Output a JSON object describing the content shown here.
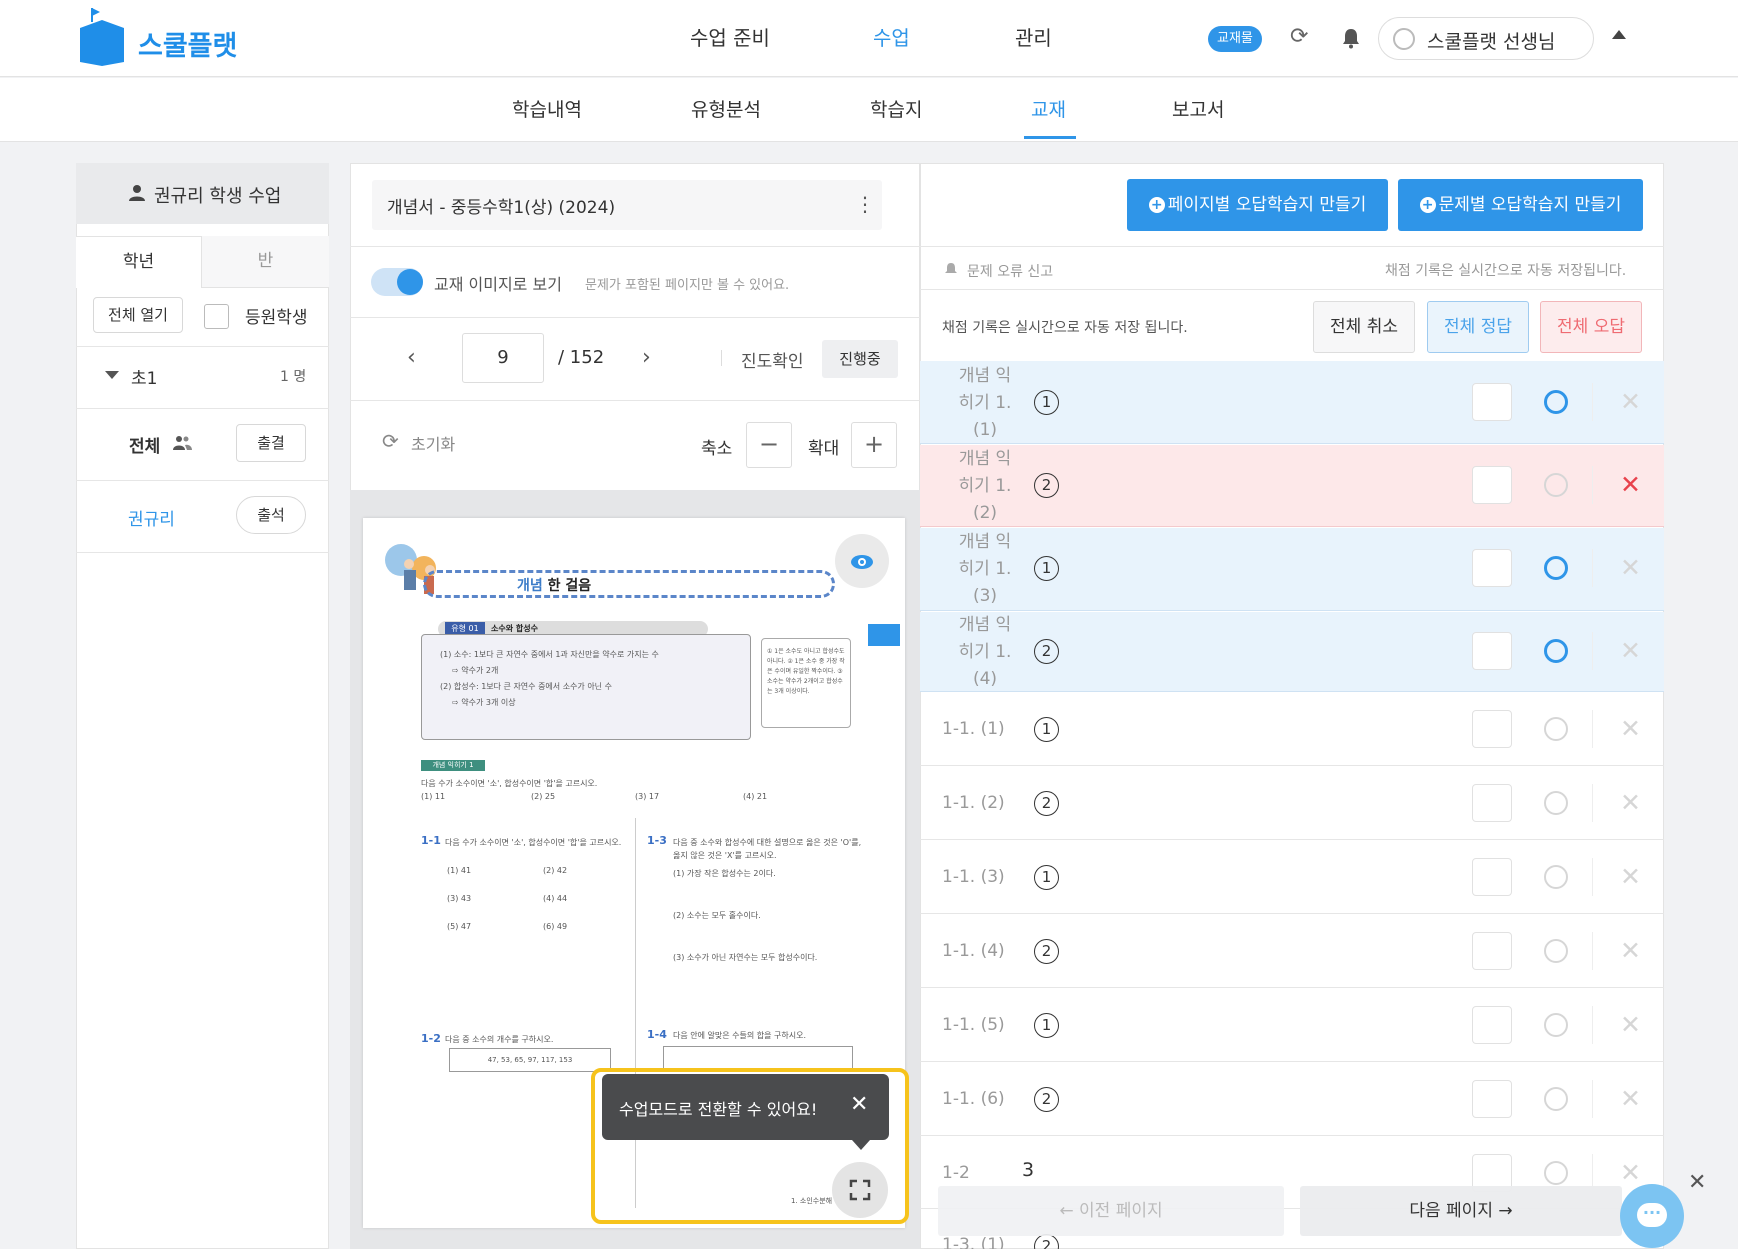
{
  "app": {
    "brand": "스쿨플랫",
    "badge": "교재물",
    "user": "스쿨플랫 선생님"
  },
  "nav": {
    "items": [
      "수업 준비",
      "수업",
      "관리"
    ]
  },
  "subnav": {
    "items": [
      "학습내역",
      "유형분석",
      "학습지",
      "교재",
      "보고서"
    ]
  },
  "left": {
    "header": "권규리 학생 수업",
    "tabs": [
      "학년",
      "반"
    ],
    "open_all": "전체 열기",
    "enrolled": "등원학생",
    "grade": "초1",
    "grade_count": "1 명",
    "all_label": "전체",
    "attend_all": "출결",
    "student": "권규리",
    "student_status": "출석"
  },
  "middle": {
    "book_title": "개념서 - 중등수학1(상) (2024)",
    "toggle_label": "교재 이미지로 보기",
    "toggle_hint": "문제가 포함된 페이지만 볼 수 있어요.",
    "page_current": "9",
    "page_total": "/ 152",
    "progress_label": "진도확인",
    "progress_status": "진행중",
    "reset": "초기화",
    "zoom_out": "축소",
    "zoom_in": "확대",
    "tooltip": "수업모드로 전환할 수 있어요!"
  },
  "textbook": {
    "header_title_1": "개념",
    "header_title_2": "한 걸음",
    "type_badge": "유형 01",
    "type_title": "소수와 합성수",
    "box_lines": [
      "(1) 소수: 1보다 큰 자연수 중에서 1과 자신만을 약수로 가지는 수",
      "⇨ 약수가 2개",
      "(2) 합성수: 1보다 큰 자연수 중에서 소수가 아닌 수",
      "⇨ 약수가 3개 이상"
    ],
    "side_note": "① 1은 소수도 아니고 합성수도 아니다. ② 1은 소수 중 가장 작은 수이며 유일한 짝수이다. ③ 소수는 약수가 2개이고 합성수는 3개 이상이다.",
    "concept_tag": "개념 익히기 1",
    "q_main": "다음 수가 소수이면 '소', 합성수이면 '합'을 고르시오.",
    "q_main_opts": [
      "(1) 11",
      "(2) 25",
      "(3) 17",
      "(4) 21"
    ],
    "q11": "다음 수가 소수이면 '소', 합성수이면 '합'을 고르시오.",
    "q11_opts": [
      "(1) 41",
      "(2) 42",
      "(3) 43",
      "(4) 44",
      "(5) 47",
      "(6) 49"
    ],
    "q13": "다음 중 소수와 합성수에 대한 설명으로 옳은 것은 'O'를, 옳지 않은 것은 'X'를 고르시오.",
    "q13_items": [
      "(1) 가장 작은 합성수는 2이다.",
      "(2) 소수는 모두 홀수이다.",
      "(3) 소수가 아닌 자연수는 모두 합성수이다."
    ],
    "q12": "다음 중 소수의 개수를 구하시오.",
    "q12_values": "47, 53, 65, 97, 117, 153",
    "q14": "다음 안에 알맞은 수들의 합을 구하시오.",
    "footer": "1. 소인수분해 · 9"
  },
  "right": {
    "report": "문제 오류 신고",
    "autosave_top": "채점 기록은 실시간으로 자동 저장됩니다.",
    "autosave": "채점 기록은 실시간으로 자동 저장 됩니다.",
    "cancel_all": "전체 취소",
    "all_correct": "전체 정답",
    "all_wrong": "전체 오답",
    "make_page": "페이지별 오답학습지 만들기",
    "make_problem": "문제별 오답학습지 만들기",
    "rows": [
      {
        "label": [
          "개념 익",
          "히기 1.",
          "(1)"
        ],
        "answer": "1",
        "state": "correct"
      },
      {
        "label": [
          "개념 익",
          "히기 1.",
          "(2)"
        ],
        "answer": "2",
        "state": "wrong"
      },
      {
        "label": [
          "개념 익",
          "히기 1.",
          "(3)"
        ],
        "answer": "1",
        "state": "correct"
      },
      {
        "label": [
          "개념 익",
          "히기 1.",
          "(4)"
        ],
        "answer": "2",
        "state": "correct"
      },
      {
        "label": [
          "1-1. (1)"
        ],
        "answer": "1",
        "state": "none"
      },
      {
        "label": [
          "1-1. (2)"
        ],
        "answer": "2",
        "state": "none"
      },
      {
        "label": [
          "1-1. (3)"
        ],
        "answer": "1",
        "state": "none"
      },
      {
        "label": [
          "1-1. (4)"
        ],
        "answer": "2",
        "state": "none"
      },
      {
        "label": [
          "1-1. (5)"
        ],
        "answer": "1",
        "state": "none"
      },
      {
        "label": [
          "1-1. (6)"
        ],
        "answer": "2",
        "state": "none"
      },
      {
        "label": [
          "1-2"
        ],
        "answer": "3",
        "state": "none"
      },
      {
        "label": [
          "1-3. (1)"
        ],
        "answer": "2",
        "state": "none"
      }
    ],
    "prev_page": "이전 페이지",
    "next_page": "다음 페이지"
  },
  "colors": {
    "accent": "#2f95e8",
    "wrong": "#e8424c",
    "correct_bg": "#e8f3fc",
    "wrong_bg": "#fde8e9",
    "highlight": "#f6c31c"
  }
}
